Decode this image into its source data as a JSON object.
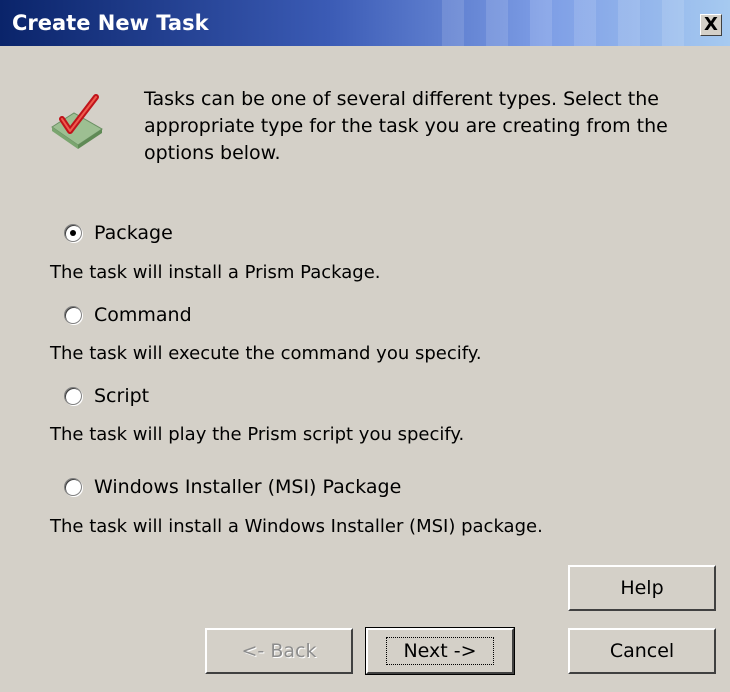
{
  "window": {
    "title": "Create New Task",
    "close_label": "X"
  },
  "header": {
    "icon": "checkmark-icon",
    "text": "Tasks can be one of several different types.  Select the appropriate type for the task you are creating from the options below."
  },
  "options": [
    {
      "label": "Package",
      "description": "The task will install a Prism Package.",
      "selected": true
    },
    {
      "label": "Command",
      "description": "The task will execute the command you specify.",
      "selected": false
    },
    {
      "label": "Script",
      "description": "The task will play the Prism script you specify.",
      "selected": false
    },
    {
      "label": "Windows Installer (MSI) Package",
      "description": "The task will install a Windows Installer (MSI) package.",
      "selected": false
    }
  ],
  "buttons": {
    "help": "Help",
    "back": "<- Back",
    "next": "Next ->",
    "cancel": "Cancel"
  }
}
